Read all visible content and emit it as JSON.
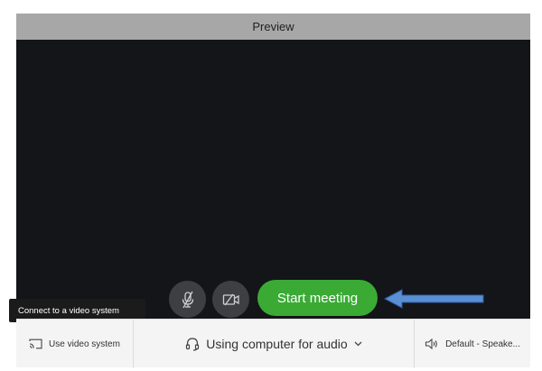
{
  "preview": {
    "title": "Preview"
  },
  "controls": {
    "mute_icon": "microphone-muted-icon",
    "camera_icon": "camera-off-icon",
    "start_label": "Start meeting",
    "start_color": "#3aaa35"
  },
  "tooltip": {
    "text": "Connect to a video system"
  },
  "bottom_bar": {
    "video_system_label": "Use video system",
    "audio_label": "Using computer for audio",
    "speaker_label": "Default - Speake..."
  },
  "annotation": {
    "arrow_color": "#5b8fd4"
  }
}
